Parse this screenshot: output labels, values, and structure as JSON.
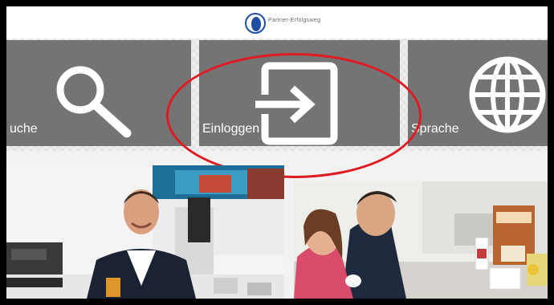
{
  "header": {
    "brand_text": "Partner-Erfolgsweg",
    "logo_icon": "company-logo-icon"
  },
  "tiles": [
    {
      "label": "uche",
      "icon": "search-icon"
    },
    {
      "label": "Einloggen",
      "icon": "login-icon"
    },
    {
      "label": "Sprache",
      "icon": "globe-icon"
    }
  ],
  "annotation": {
    "color": "#e01a22"
  },
  "colors": {
    "tile": "#747474",
    "header": "#ffffff",
    "frame": "#000000"
  }
}
